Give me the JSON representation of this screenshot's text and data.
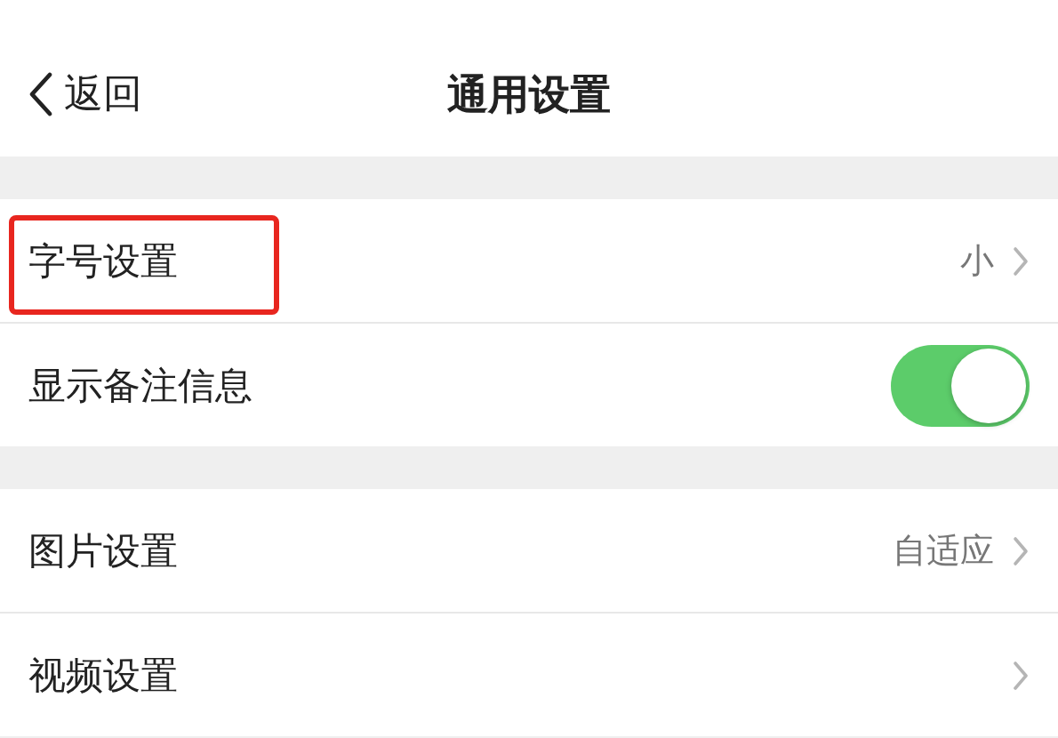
{
  "nav": {
    "back_label": "返回",
    "title": "通用设置"
  },
  "sections": [
    {
      "rows": [
        {
          "kind": "link",
          "label": "字号设置",
          "value": "小",
          "highlighted": true
        },
        {
          "kind": "toggle",
          "label": "显示备注信息",
          "on": true,
          "highlighted": false
        }
      ]
    },
    {
      "rows": [
        {
          "kind": "link",
          "label": "图片设置",
          "value": "自适应",
          "highlighted": false
        },
        {
          "kind": "link",
          "label": "视频设置",
          "highlighted": false
        }
      ]
    }
  ]
}
